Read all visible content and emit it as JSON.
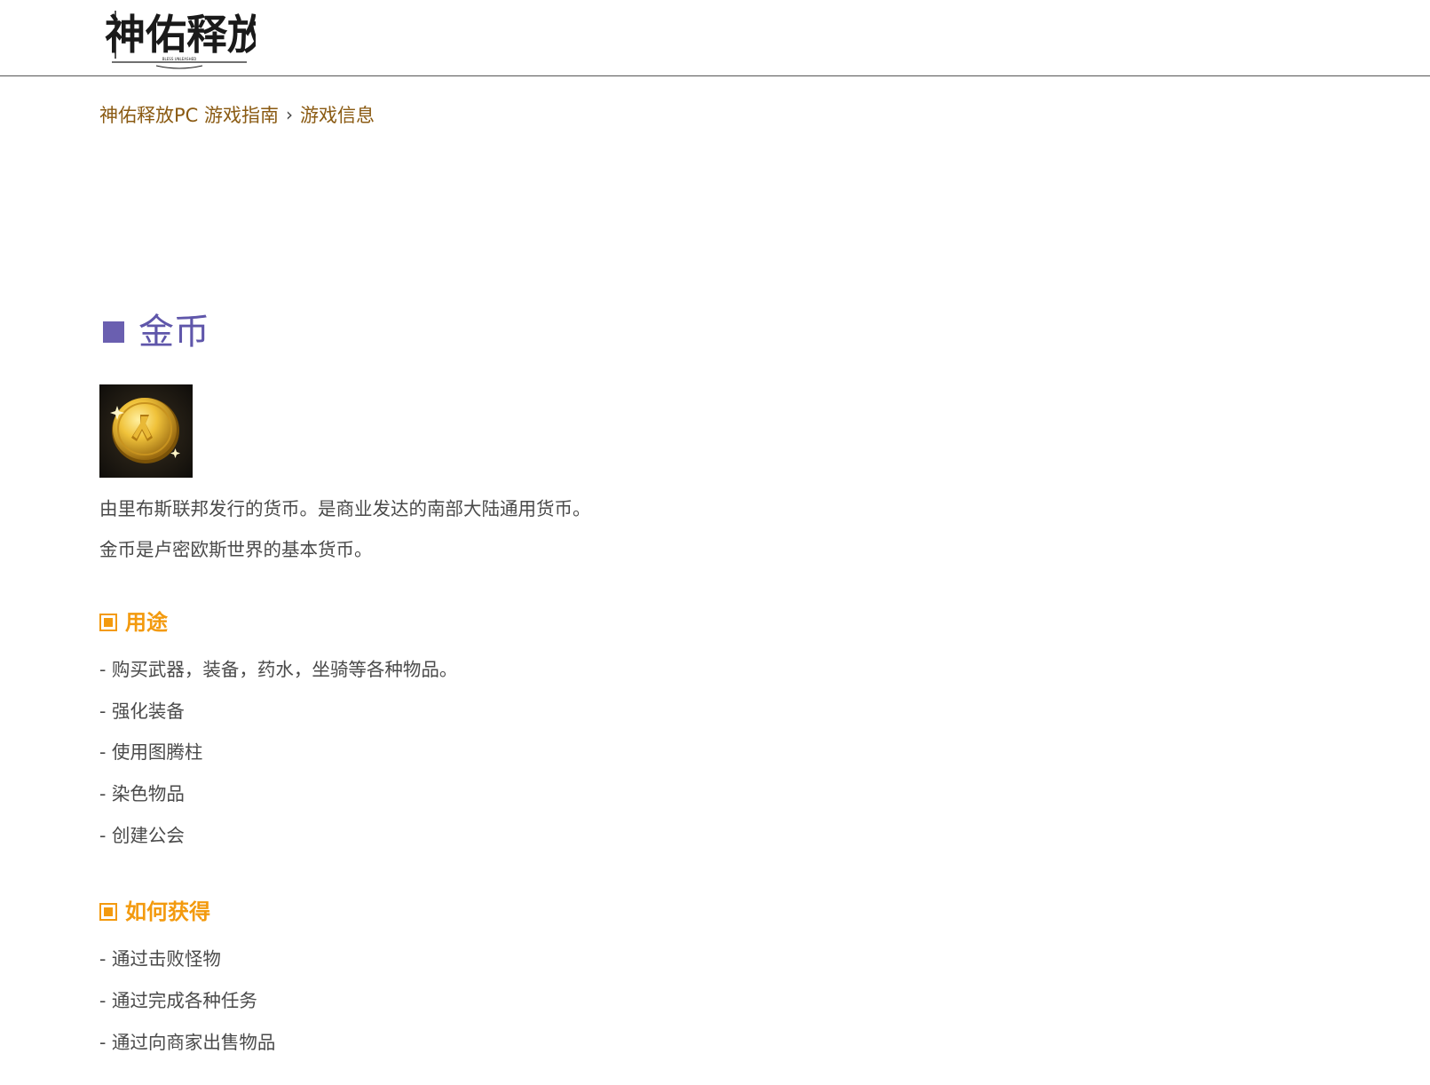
{
  "header": {
    "logo_text": "神佑释放",
    "logo_subtitle": "BLESS UNLEASHED"
  },
  "breadcrumb": {
    "home": "神佑释放PC 游戏指南",
    "separator": "›",
    "current": "游戏信息"
  },
  "section": {
    "title": "金币",
    "icon": "gold-coin-icon",
    "description": [
      "由里布斯联邦发行的货币。是商业发达的南部大陆通用货币。",
      "金币是卢密欧斯世界的基本货币。"
    ]
  },
  "uses": {
    "heading": "用途",
    "items": [
      "- 购买武器，装备，药水，坐骑等各种物品。",
      "- 强化装备",
      "- 使用图腾柱",
      "- 染色物品",
      "- 创建公会"
    ]
  },
  "obtain": {
    "heading": "如何获得",
    "items": [
      "- 通过击败怪物",
      "- 通过完成各种任务",
      "- 通过向商家出售物品"
    ]
  },
  "colors": {
    "breadcrumb": "#8a5a12",
    "title": "#5f56aa",
    "subheading": "#f39a0e",
    "body_text": "#4a4a4a"
  }
}
